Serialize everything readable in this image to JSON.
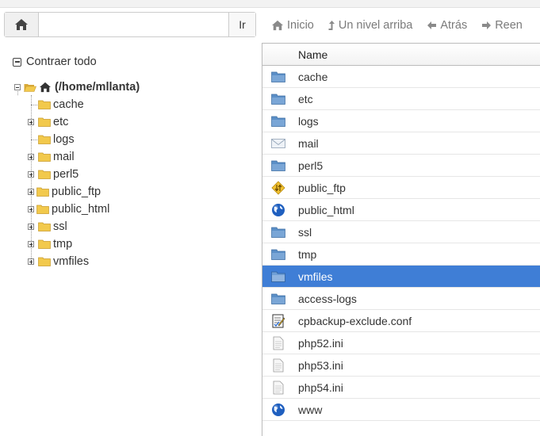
{
  "path_bar": {
    "home_icon": "home-icon",
    "path_value": "",
    "go_label": "Ir"
  },
  "toolbar": {
    "items": [
      {
        "label": "Inicio",
        "icon": "home-icon"
      },
      {
        "label": "Un nivel arriba",
        "icon": "level-up-icon"
      },
      {
        "label": "Atrás",
        "icon": "arrow-left-icon"
      },
      {
        "label": "Reen",
        "icon": "arrow-right-icon"
      }
    ]
  },
  "tree": {
    "collapse_all_label": "Contraer todo",
    "root_label": "(/home/mllanta)",
    "children": [
      {
        "label": "cache",
        "expandable": false
      },
      {
        "label": "etc",
        "expandable": true
      },
      {
        "label": "logs",
        "expandable": false
      },
      {
        "label": "mail",
        "expandable": true
      },
      {
        "label": "perl5",
        "expandable": true
      },
      {
        "label": "public_ftp",
        "expandable": true
      },
      {
        "label": "public_html",
        "expandable": true
      },
      {
        "label": "ssl",
        "expandable": true
      },
      {
        "label": "tmp",
        "expandable": true
      },
      {
        "label": "vmfiles",
        "expandable": true
      }
    ]
  },
  "file_list": {
    "column_header": "Name",
    "selected_index": 9,
    "rows": [
      {
        "name": "cache",
        "icon": "folder-icon"
      },
      {
        "name": "etc",
        "icon": "folder-icon"
      },
      {
        "name": "logs",
        "icon": "folder-icon"
      },
      {
        "name": "mail",
        "icon": "mail-icon"
      },
      {
        "name": "perl5",
        "icon": "folder-icon"
      },
      {
        "name": "public_ftp",
        "icon": "ftp-icon"
      },
      {
        "name": "public_html",
        "icon": "globe-icon"
      },
      {
        "name": "ssl",
        "icon": "folder-icon"
      },
      {
        "name": "tmp",
        "icon": "folder-icon"
      },
      {
        "name": "vmfiles",
        "icon": "folder-icon"
      },
      {
        "name": "access-logs",
        "icon": "folder-icon"
      },
      {
        "name": "cpbackup-exclude.conf",
        "icon": "config-file-icon"
      },
      {
        "name": "php52.ini",
        "icon": "text-file-icon"
      },
      {
        "name": "php53.ini",
        "icon": "text-file-icon"
      },
      {
        "name": "php54.ini",
        "icon": "text-file-icon"
      },
      {
        "name": "www",
        "icon": "globe-icon"
      }
    ]
  },
  "colors": {
    "selection": "#3f7ed6",
    "folder_blue": "#5b8fc7",
    "folder_yellow": "#f2c94c"
  }
}
